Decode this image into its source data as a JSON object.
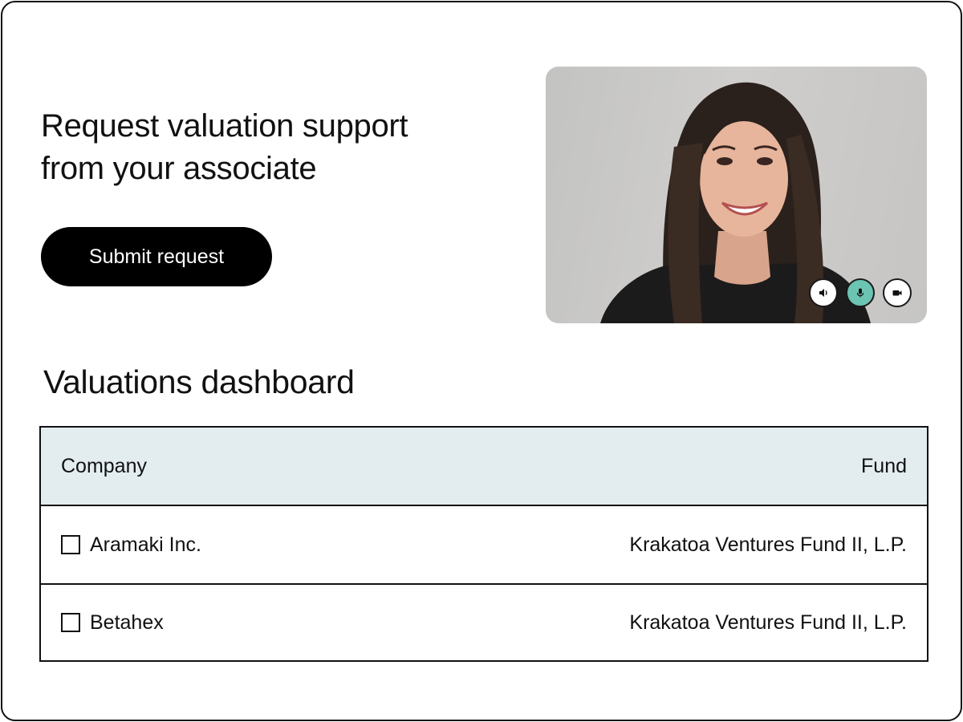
{
  "hero": {
    "headline_line1": "Request valuation support",
    "headline_line2": "from your associate",
    "submit_label": "Submit request"
  },
  "video_call": {
    "controls": [
      {
        "icon": "speaker-icon",
        "active": false
      },
      {
        "icon": "microphone-icon",
        "active": true
      },
      {
        "icon": "video-camera-icon",
        "active": false
      }
    ],
    "active_color": "#6cc4b3"
  },
  "dashboard": {
    "title": "Valuations dashboard",
    "columns": [
      "Company",
      "Fund"
    ],
    "rows": [
      {
        "company": "Aramaki Inc.",
        "fund": "Krakatoa Ventures Fund II, L.P.",
        "checked": false
      },
      {
        "company": "Betahex",
        "fund": "Krakatoa Ventures Fund II, L.P.",
        "checked": false
      }
    ],
    "header_bg": "#e3edf0"
  }
}
